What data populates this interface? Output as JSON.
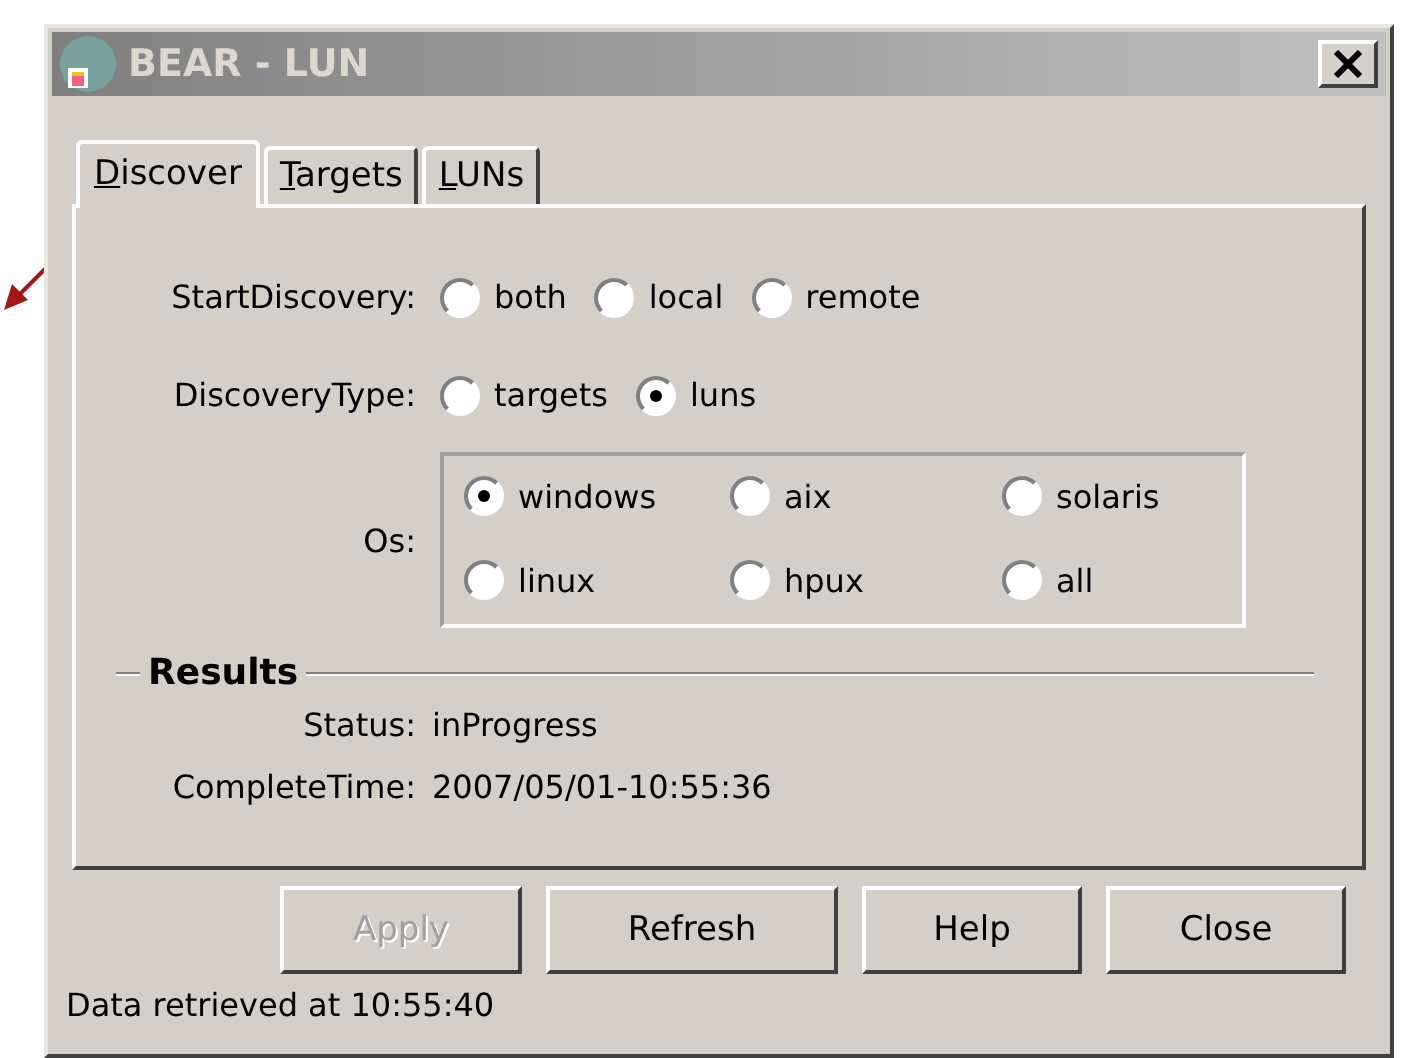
{
  "window": {
    "title": "BEAR - LUN"
  },
  "tabs": [
    {
      "label": "Discover",
      "selected": true
    },
    {
      "label": "Targets",
      "selected": false
    },
    {
      "label": "LUNs",
      "selected": false
    }
  ],
  "start_discovery": {
    "label": "StartDiscovery:",
    "options": [
      {
        "label": "both",
        "selected": false
      },
      {
        "label": "local",
        "selected": false
      },
      {
        "label": "remote",
        "selected": false
      }
    ]
  },
  "discovery_type": {
    "label": "DiscoveryType:",
    "options": [
      {
        "label": "targets",
        "selected": false
      },
      {
        "label": "luns",
        "selected": true
      }
    ]
  },
  "os": {
    "label": "Os:",
    "options": [
      {
        "label": "windows",
        "selected": true
      },
      {
        "label": "aix",
        "selected": false
      },
      {
        "label": "solaris",
        "selected": false
      },
      {
        "label": "linux",
        "selected": false
      },
      {
        "label": "hpux",
        "selected": false
      },
      {
        "label": "all",
        "selected": false
      }
    ]
  },
  "results": {
    "title": "Results",
    "fields": [
      {
        "label": "Status:",
        "value": "inProgress"
      },
      {
        "label": "CompleteTime:",
        "value": "2007/05/01-10:55:36"
      }
    ]
  },
  "buttons": [
    {
      "label": "Apply",
      "disabled": true
    },
    {
      "label": "Refresh",
      "disabled": false
    },
    {
      "label": "Help",
      "disabled": false
    },
    {
      "label": "Close",
      "disabled": false
    }
  ],
  "status_bar": "Data retrieved at 10:55:40"
}
